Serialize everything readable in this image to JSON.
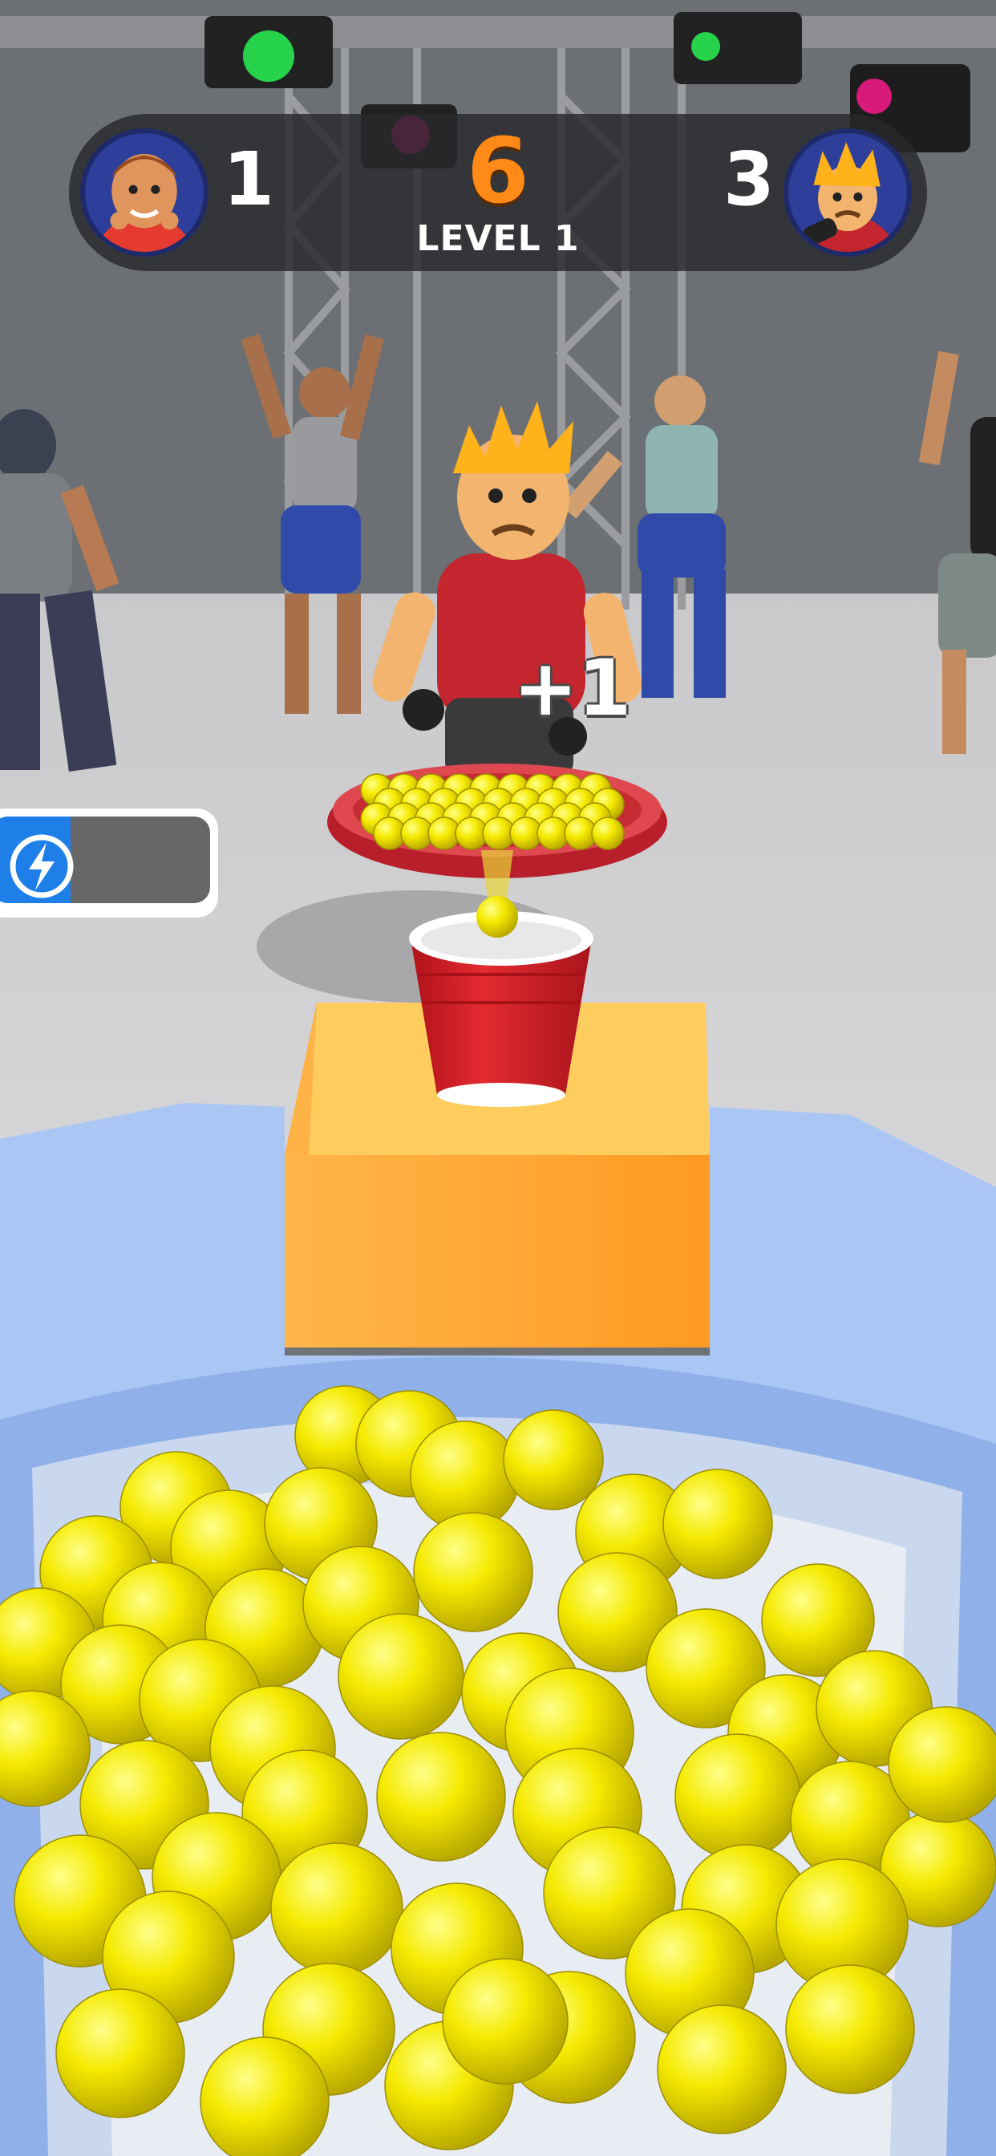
{
  "hud": {
    "player_score": "1",
    "center_score": "6",
    "level_label": "LEVEL 1",
    "opponent_score": "3"
  },
  "floating_text": "+1",
  "boost": {
    "icon": "lightning-icon",
    "fill_fraction": 0.36
  },
  "colors": {
    "score_orange": "#ff8a18",
    "boost_blue": "#1f7fe8",
    "ball_yellow": "#f2e600",
    "cup_red": "#d81f26",
    "plate_red": "#cc2530",
    "box_orange": "#ffa733",
    "bowl_blue": "#9fbfef"
  }
}
